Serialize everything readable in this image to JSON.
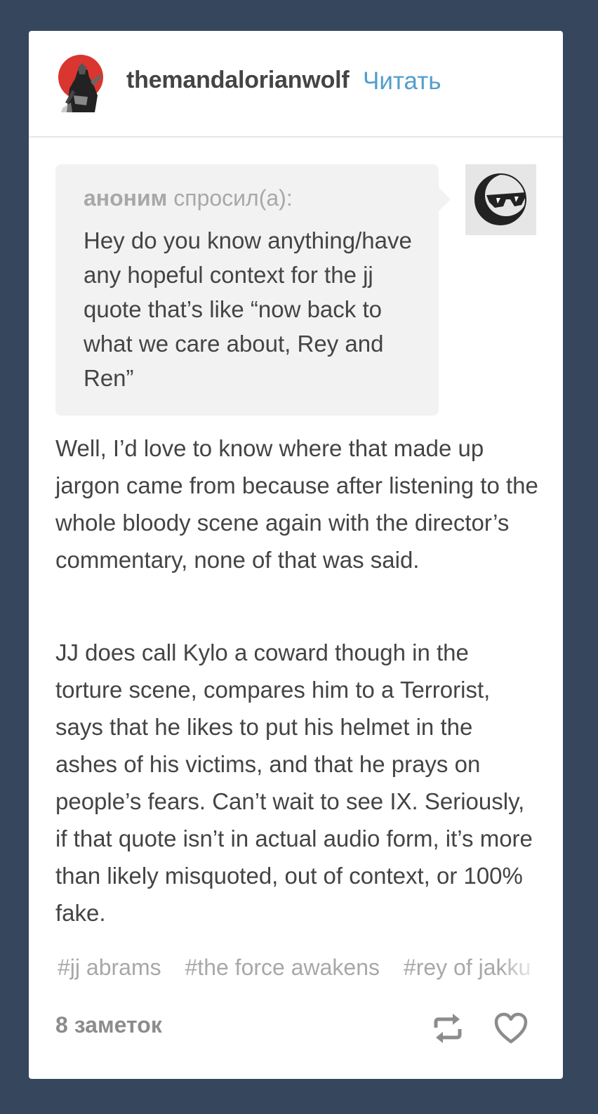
{
  "post": {
    "blog_name": "themandalorianwolf",
    "follow_label": "Читать",
    "avatar_icon": "mandalorian-avatar-icon",
    "ask": {
      "asker": "аноним",
      "asked_label": "спросил(а):",
      "question": "Hey do you know anything/have any hopeful context for the jj quote that’s like “now back to what we care about, Rey and Ren”",
      "anon_avatar_icon": "sunglasses-avatar-icon"
    },
    "answer": [
      "Well, I’d love to know where that made up jargon came from because after listening to the whole bloody scene again with the director’s commentary, none of that was said.",
      "JJ does call Kylo a coward though in the torture scene, compares him to a Terrorist, says that he likes to put his helmet in the ashes of his victims, and that he prays on people’s fears. Can’t wait to see IX. Seriously, if that quote isn’t in actual audio form, it’s more than likely misquoted, out of context, or 100% fake."
    ],
    "tags": [
      "#jj abrams",
      "#the force awakens",
      "#rey of jakku"
    ],
    "notes_label": "8 заметок",
    "actions": {
      "reblog_icon": "reblog-icon",
      "like_icon": "heart-icon"
    }
  },
  "colors": {
    "background": "#36465d",
    "card": "#ffffff",
    "link": "#529ecc",
    "muted_text": "#a8a8a8",
    "body_text": "#444444",
    "ask_bubble": "#f2f2f2"
  }
}
